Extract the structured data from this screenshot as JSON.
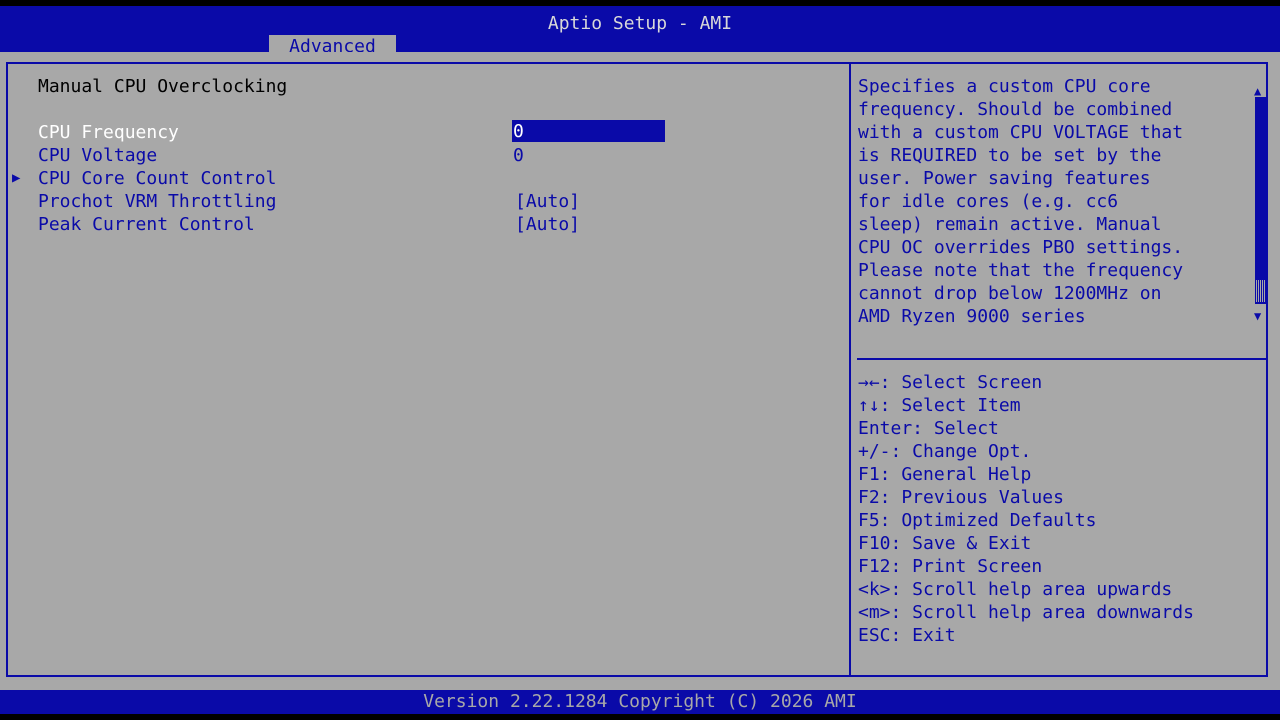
{
  "header": {
    "title": "Aptio Setup - AMI",
    "active_tab": "Advanced"
  },
  "page": {
    "section_title": "Manual CPU Overclocking",
    "items": [
      {
        "label": "CPU Frequency",
        "value": "0",
        "selected": true
      },
      {
        "label": "CPU Voltage",
        "value": "0"
      },
      {
        "label": "CPU Core Count Control",
        "value": "",
        "submenu": true
      },
      {
        "label": "Prochot VRM Throttling",
        "value": "[Auto]"
      },
      {
        "label": "Peak Current Control",
        "value": "[Auto]"
      }
    ]
  },
  "help": {
    "lines": [
      "Specifies a custom CPU core",
      "frequency. Should be combined",
      "with a custom CPU VOLTAGE that",
      "is REQUIRED to be set by the",
      "user. Power saving features",
      "for idle cores (e.g. cc6",
      "sleep) remain active. Manual",
      "CPU OC overrides PBO settings.",
      "Please note that the frequency",
      "cannot drop below 1200MHz on",
      "AMD Ryzen 9000 series"
    ]
  },
  "keys": {
    "lines": [
      "→←: Select Screen",
      "↑↓: Select Item",
      "Enter: Select",
      "+/-: Change Opt.",
      "F1: General Help",
      "F2: Previous Values",
      "F5: Optimized Defaults",
      "F10: Save & Exit",
      "F12: Print Screen",
      "<k>: Scroll help area upwards",
      "<m>: Scroll help area downwards",
      "ESC: Exit"
    ]
  },
  "footer": {
    "version": "Version 2.22.1284 Copyright (C) 2026 AMI"
  },
  "colors": {
    "bios_blue": "#0a0aa8",
    "bios_gray": "#a8a8a8",
    "selected_text": "#ffffff"
  }
}
